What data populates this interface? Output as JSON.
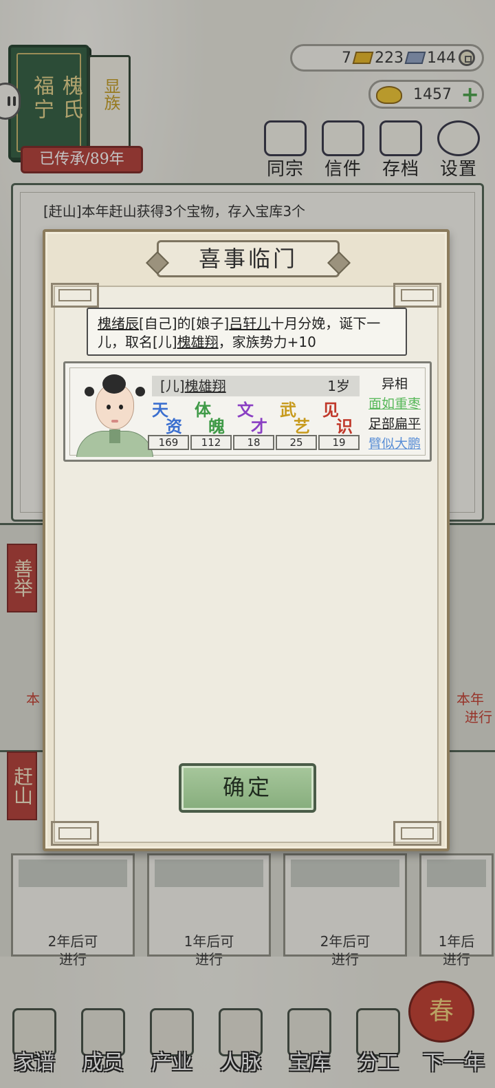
{
  "family": {
    "title_left": "福宁",
    "title_right": "槐氏",
    "rank": "显族",
    "legacy": "已传承/89年"
  },
  "currency": {
    "gold_bars": "7",
    "silver_bars": "223",
    "coins": "144",
    "ingots": "1457",
    "plus": "+"
  },
  "top_nav": [
    "同宗",
    "信件",
    "存档",
    "设置"
  ],
  "log": {
    "line": "[赶山]本年赶山获得3个宝物，存入宝库3个"
  },
  "background": {
    "side_tag_1": "善举",
    "side_tag_2": "赶山",
    "note_left": "本",
    "note_right_1": "本年",
    "note_right_2": "进行",
    "cards": [
      "2年后可\n进行",
      "1年后可\n进行",
      "2年后可\n进行",
      "1年后\n进行"
    ]
  },
  "bottom_nav": [
    "家谱",
    "成员",
    "产业",
    "人脉",
    "宝库",
    "分工",
    "下一年"
  ],
  "lantern": "春",
  "modal": {
    "title": "喜事临门",
    "event": {
      "p1": "槐绪辰",
      "p2": "[自己]的[娘子]",
      "p3": "吕轩儿",
      "p4": "十月分娩，诞下一儿，取名[儿]",
      "p5": "槐雄翔",
      "p6": "，家族势力+10"
    },
    "character": {
      "relation": "[儿]",
      "name": "槐雄翔",
      "age": "1岁",
      "stats": [
        {
          "top": "天",
          "bottom": "资",
          "value": "169",
          "color": "#3b6fcf"
        },
        {
          "top": "体",
          "bottom": "魄",
          "value": "112",
          "color": "#3f9a47"
        },
        {
          "top": "文",
          "bottom": "才",
          "value": "18",
          "color": "#8a3fc3"
        },
        {
          "top": "武",
          "bottom": "艺",
          "value": "25",
          "color": "#c79a1c"
        },
        {
          "top": "见",
          "bottom": "识",
          "value": "19",
          "color": "#c0392b"
        }
      ],
      "traits_header": "异相",
      "traits": [
        "面如重枣",
        "足部扁平",
        "臂似大鹏"
      ]
    },
    "confirm": "确定"
  }
}
